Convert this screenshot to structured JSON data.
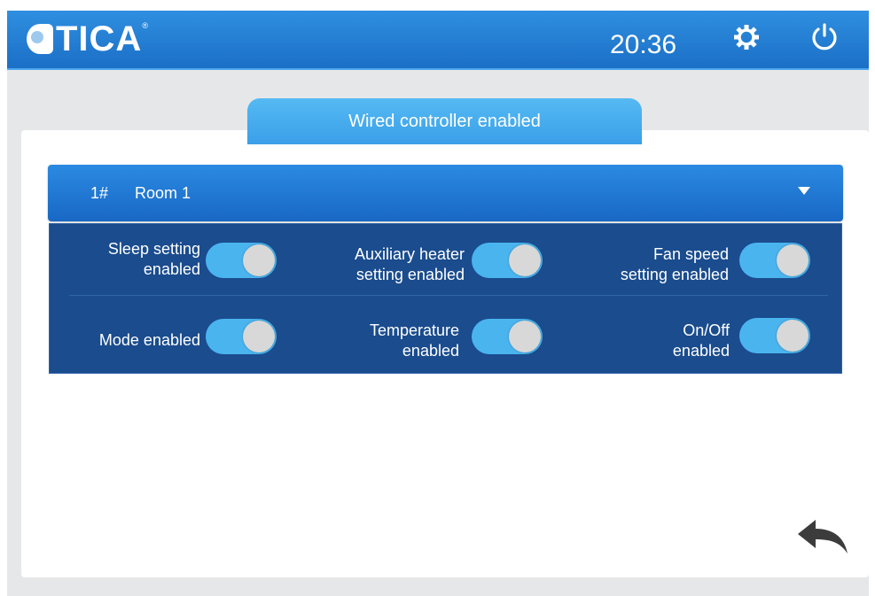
{
  "header": {
    "brand": "TICA",
    "time": "20:36",
    "settings_icon": "gear-icon",
    "power_icon": "power-icon",
    "color": "#1f7bd3"
  },
  "tab": {
    "title": "Wired controller enabled"
  },
  "room_selector": {
    "number": "1#",
    "name": "Room 1",
    "dropdown_icon": "triangle-down-icon"
  },
  "settings": [
    {
      "label": "Sleep setting enabled",
      "lines": [
        "Sleep setting",
        "enabled"
      ],
      "on": true
    },
    {
      "label": "Auxiliary heater setting enabled",
      "lines": [
        "Auxiliary heater",
        "setting enabled"
      ],
      "on": true
    },
    {
      "label": "Fan speed setting enabled",
      "lines": [
        "Fan speed",
        "setting enabled"
      ],
      "on": true
    },
    {
      "label": "Mode enabled",
      "lines": [
        "Mode enabled"
      ],
      "on": true
    },
    {
      "label": "Temperature enabled",
      "lines": [
        "Temperature",
        "enabled"
      ],
      "on": true
    },
    {
      "label": "On/Off enabled",
      "lines": [
        "On/Off",
        "enabled"
      ],
      "on": true
    }
  ],
  "colors": {
    "toggle_on": "#4ab4ef",
    "panel": "#1a4c8e"
  },
  "footer": {
    "back_icon": "back-arrow-icon"
  }
}
